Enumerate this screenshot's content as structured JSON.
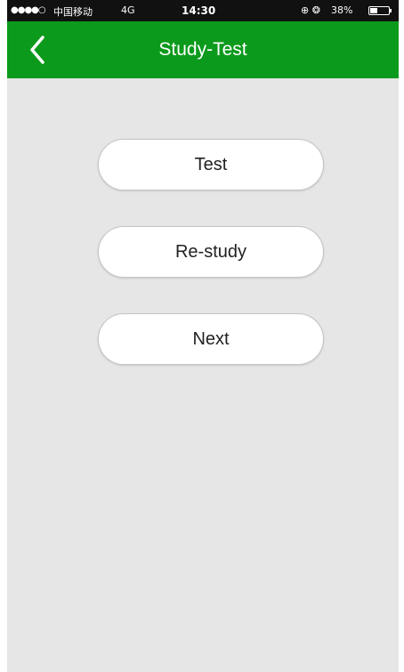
{
  "status_bar": {
    "signal": "●●●●○",
    "carrier": "中国移动",
    "network": "4G",
    "time": "14:30",
    "icons": "⊕ ❂",
    "battery_text": "38%",
    "battery_level": 0.38
  },
  "nav": {
    "title": "Study-Test",
    "back_icon": "chevron-left-icon"
  },
  "actions": {
    "test_label": "Test",
    "restudy_label": "Re-study",
    "next_label": "Next"
  },
  "colors": {
    "nav_background": "#0c9a1c",
    "content_background": "#e6e6e6",
    "button_background": "#ffffff"
  }
}
